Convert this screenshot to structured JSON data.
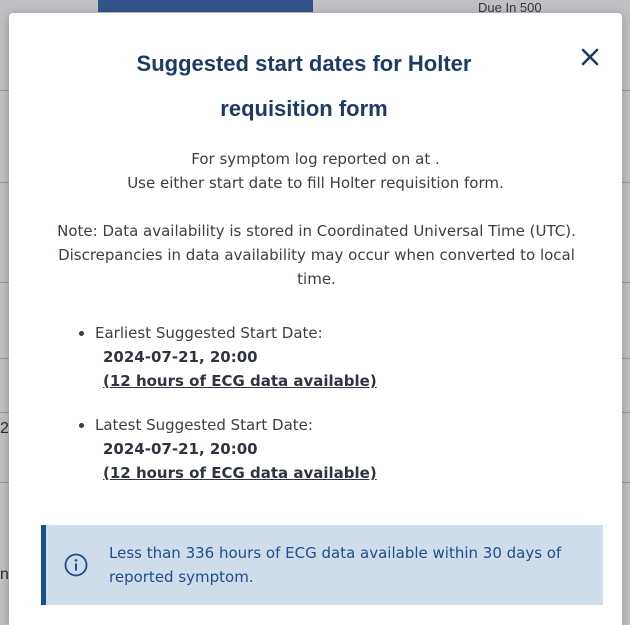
{
  "background": {
    "top_text": "Due In 500",
    "fragment_1": "2",
    "fragment_2": "ng"
  },
  "modal": {
    "title": "Suggested start dates for Holter requisition form",
    "close_icon": "close-icon",
    "intro_line1": "For symptom log reported on at .",
    "intro_line2": "Use either start date to fill Holter requisition form.",
    "note": "Note: Data availability is stored in Coordinated Universal Time (UTC). Discrepancies in data availability may occur when converted to local time.",
    "dates": [
      {
        "label": "Earliest Suggested Start Date:",
        "value": "2024-07-21, 20:00",
        "link": "(12 hours of ECG data available)"
      },
      {
        "label": "Latest Suggested Start Date:",
        "value": "2024-07-21, 20:00",
        "link": "(12 hours of ECG data available)"
      }
    ],
    "alert": {
      "icon": "info-icon",
      "text": "Less than 336 hours of ECG data available within 30 days of reported symptom."
    }
  },
  "colors": {
    "title": "#1f3b63",
    "body_text": "#3a3f47",
    "alert_background": "#cfdcea",
    "alert_accent": "#1e4f8c",
    "active_tab": "#2a5aa6"
  }
}
